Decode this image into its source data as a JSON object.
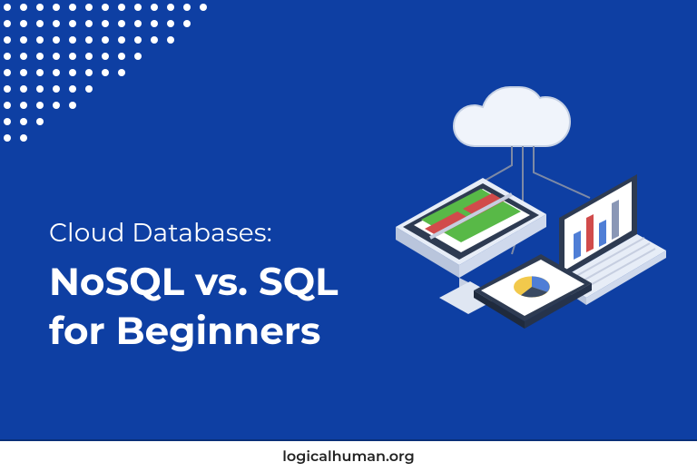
{
  "hero": {
    "kicker": "Cloud Databases:",
    "headline_line1": "NoSQL vs. SQL",
    "headline_line2": "for Beginners"
  },
  "footer": {
    "site": "logicalhuman.org"
  },
  "palette": {
    "bg": "#0e3fa3",
    "white": "#ffffff",
    "accent_green": "#58b947",
    "accent_red": "#d14b4b",
    "accent_blue": "#4f7ed6",
    "accent_yellow": "#f2c94c",
    "slate": "#3a4a63"
  }
}
